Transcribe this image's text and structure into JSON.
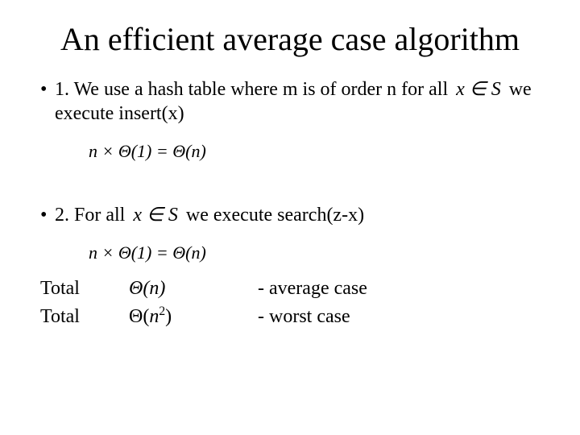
{
  "title": "An efficient average case algorithm",
  "bullets": {
    "b1_pre": "1. We use a hash table where m is of order n for all ",
    "b1_math": "x ∈ S",
    "b1_post": " we execute insert(x)",
    "formula1": "n × Θ(1) = Θ(n)",
    "b2_pre": "2. For all ",
    "b2_math": "x ∈ S",
    "b2_post": " we execute search(z-x)",
    "formula2": "n × Θ(1) = Θ(n)"
  },
  "totals": {
    "label": "Total",
    "row1_theta": "Θ(n)",
    "row1_desc": "- average case",
    "row2_theta_open": "Θ(",
    "row2_theta_n": "n",
    "row2_theta_exp": "2",
    "row2_theta_close": ")",
    "row2_desc": "- worst case"
  },
  "glyphs": {
    "bullet": "•"
  }
}
